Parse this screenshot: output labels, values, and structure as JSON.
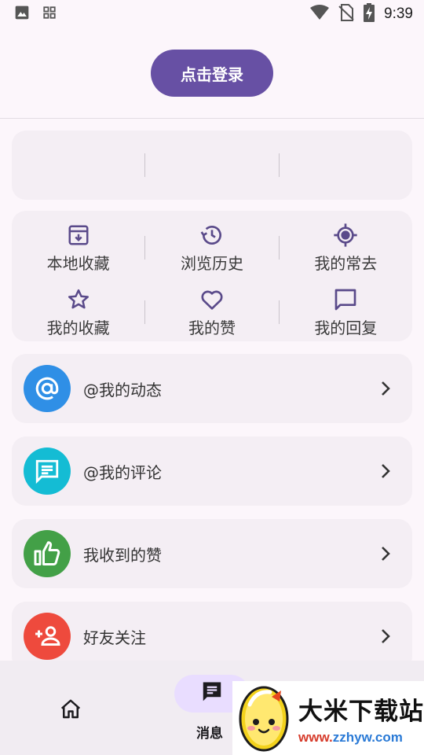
{
  "status_bar": {
    "time": "9:39",
    "left_icons": [
      "image-icon",
      "apps-grid-icon"
    ],
    "right_icons": [
      "wifi-icon",
      "no-sim-icon",
      "battery-charging-icon"
    ]
  },
  "login": {
    "label": "点击登录"
  },
  "shortcuts": [
    {
      "label": "本地收藏",
      "icon": "archive-download-icon"
    },
    {
      "label": "浏览历史",
      "icon": "history-icon"
    },
    {
      "label": "我的常去",
      "icon": "location-target-icon"
    },
    {
      "label": "我的收藏",
      "icon": "star-icon"
    },
    {
      "label": "我的赞",
      "icon": "heart-icon"
    },
    {
      "label": "我的回复",
      "icon": "comment-icon"
    }
  ],
  "list": [
    {
      "label": "@我的动态",
      "icon": "at-icon",
      "color": "#2f8fe6"
    },
    {
      "label": "@我的评论",
      "icon": "chat-icon",
      "color": "#14bcd4"
    },
    {
      "label": "我收到的赞",
      "icon": "thumb-up-icon",
      "color": "#43a047"
    },
    {
      "label": "好友关注",
      "icon": "add-person-icon",
      "color": "#ee4a3d"
    }
  ],
  "bottom_nav": {
    "home_icon": "home-icon",
    "messages_label": "消息",
    "messages_icon": "message-icon"
  },
  "watermark": {
    "title": "大米下载站",
    "url_prefix": "www.",
    "url_rest": "zzhyw.com"
  },
  "colors": {
    "primary": "#6750a4",
    "icon": "#5a4a8a",
    "background": "#fcf6fb",
    "card": "#f4eef4"
  }
}
